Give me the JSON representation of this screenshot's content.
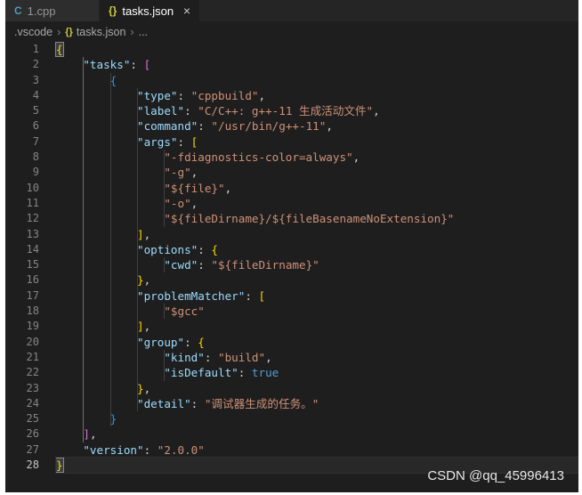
{
  "tabs": [
    {
      "icon": "C",
      "label": "1.cpp"
    },
    {
      "icon": "{}",
      "label": "tasks.json",
      "close": "×"
    }
  ],
  "breadcrumb": {
    "folder": ".vscode",
    "file_icon": "{}",
    "file": "tasks.json",
    "trail": "..."
  },
  "editor": {
    "line_numbers": [
      "1",
      "2",
      "3",
      "4",
      "5",
      "6",
      "7",
      "8",
      "9",
      "10",
      "11",
      "12",
      "13",
      "14",
      "15",
      "16",
      "17",
      "18",
      "19",
      "20",
      "21",
      "22",
      "23",
      "24",
      "25",
      "26",
      "27",
      "28"
    ],
    "active_line": "28",
    "lines": [
      "{",
      "    \"tasks\": [",
      "        {",
      "            \"type\": \"cppbuild\",",
      "            \"label\": \"C/C++: g++-11 生成活动文件\",",
      "            \"command\": \"/usr/bin/g++-11\",",
      "            \"args\": [",
      "                \"-fdiagnostics-color=always\",",
      "                \"-g\",",
      "                \"${file}\",",
      "                \"-o\",",
      "                \"${fileDirname}/${fileBasenameNoExtension}\"",
      "            ],",
      "            \"options\": {",
      "                \"cwd\": \"${fileDirname}\"",
      "            },",
      "            \"problemMatcher\": [",
      "                \"$gcc\"",
      "            ],",
      "            \"group\": {",
      "                \"kind\": \"build\",",
      "                \"isDefault\": true",
      "            },",
      "            \"detail\": \"调试器生成的任务。\"",
      "        }",
      "    ],",
      "    \"version\": \"2.0.0\"",
      "}"
    ]
  },
  "watermark": "CSDN @qq_45996413",
  "colors": {
    "background": "#1e1e1e",
    "key": "#9cdcfe",
    "string": "#ce9178",
    "boolean": "#569cd6",
    "bracket_level1": "#ffd700",
    "bracket_level2": "#da70d6",
    "bracket_level3": "#179fff"
  }
}
